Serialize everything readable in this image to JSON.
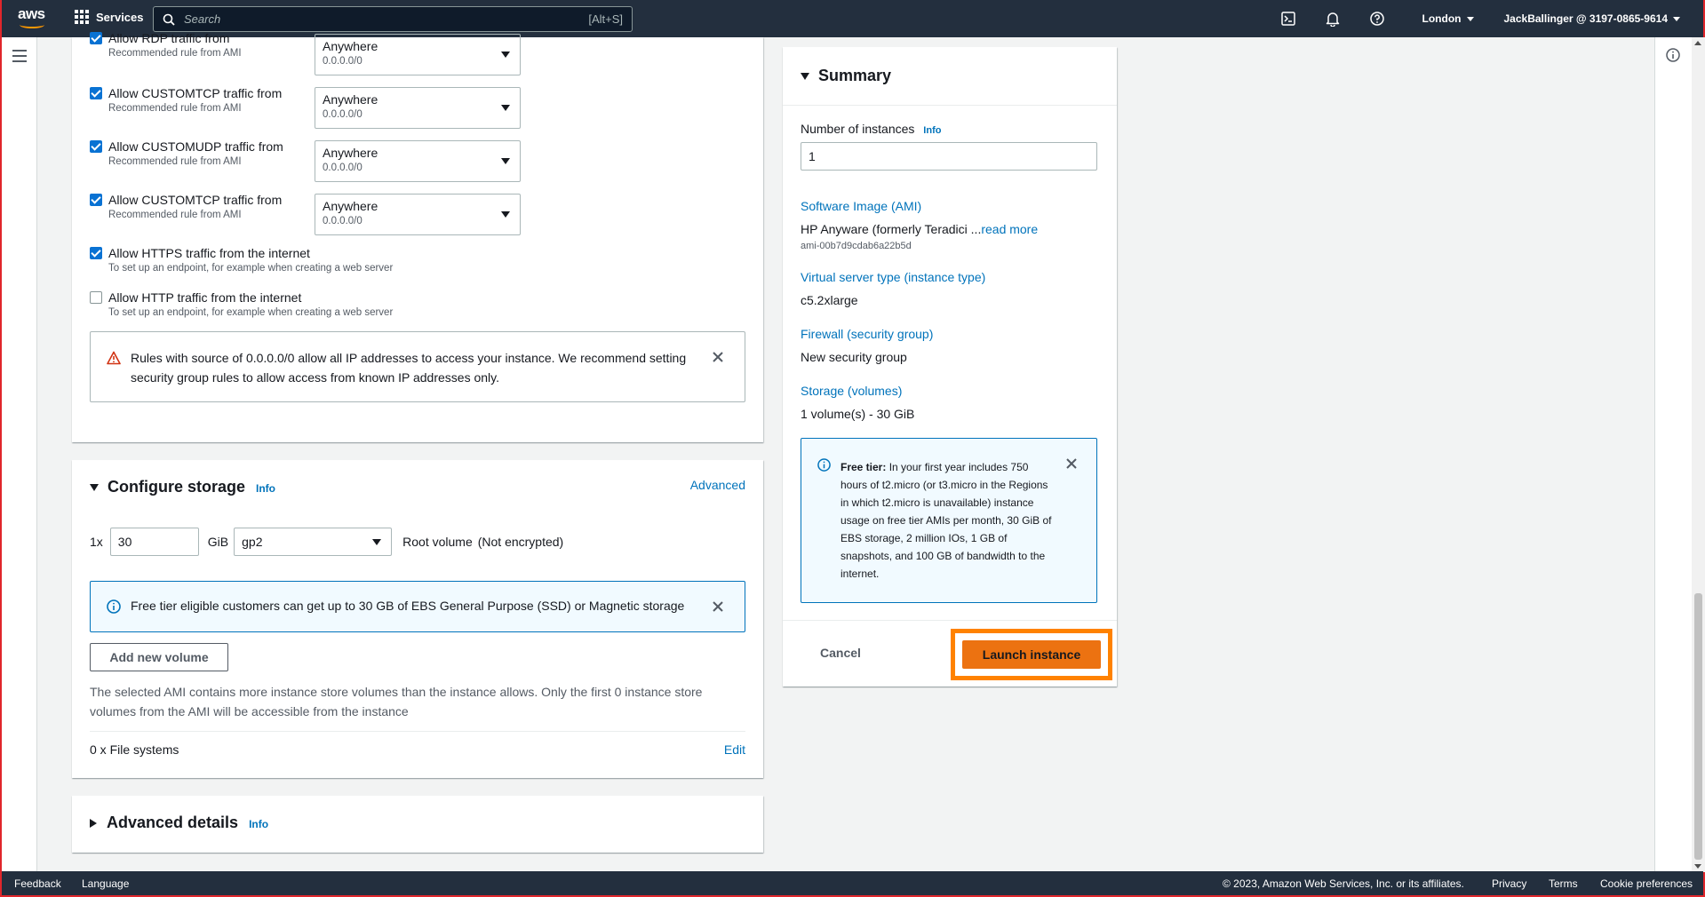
{
  "topnav": {
    "logo": "aws",
    "services_label": "Services",
    "search_placeholder": "Search",
    "search_shortcut": "[Alt+S]",
    "region": "London",
    "account": "JackBallinger @ 3197-0865-9614",
    "icons": [
      "cloudshell-icon",
      "notifications-icon",
      "help-icon"
    ]
  },
  "security_rules": [
    {
      "title": "Allow RDP traffic from",
      "subtitle": "Recommended rule from AMI",
      "checked": true,
      "source": "Anywhere",
      "cidr": "0.0.0.0/0"
    },
    {
      "title": "Allow CUSTOMTCP traffic from",
      "subtitle": "Recommended rule from AMI",
      "checked": true,
      "source": "Anywhere",
      "cidr": "0.0.0.0/0"
    },
    {
      "title": "Allow CUSTOMUDP traffic from",
      "subtitle": "Recommended rule from AMI",
      "checked": true,
      "source": "Anywhere",
      "cidr": "0.0.0.0/0"
    },
    {
      "title": "Allow CUSTOMTCP traffic from",
      "subtitle": "Recommended rule from AMI",
      "checked": true,
      "source": "Anywhere",
      "cidr": "0.0.0.0/0"
    },
    {
      "title": "Allow HTTPS traffic from the internet",
      "subtitle": "To set up an endpoint, for example when creating a web server",
      "checked": true
    },
    {
      "title": "Allow HTTP traffic from the internet",
      "subtitle": "To set up an endpoint, for example when creating a web server",
      "checked": false
    }
  ],
  "warning": "Rules with source of 0.0.0.0/0 allow all IP addresses to access your instance. We recommend setting security group rules to allow access from known IP addresses only.",
  "storage": {
    "title": "Configure storage",
    "info": "Info",
    "advanced": "Advanced",
    "count": "1x",
    "size": "30",
    "unit": "GiB",
    "volume_type": "gp2",
    "root_label": "Root volume",
    "encryption": "(Not encrypted)",
    "free_tier_note": "Free tier eligible customers can get up to 30 GB of EBS General Purpose (SSD) or Magnetic storage",
    "add_volume": "Add new volume",
    "ami_note": "The selected AMI contains more instance store volumes than the instance allows. Only the first 0 instance store volumes from the AMI will be accessible from the instance",
    "file_systems": "0 x File systems",
    "edit": "Edit"
  },
  "advanced_details": {
    "title": "Advanced details",
    "info": "Info"
  },
  "summary": {
    "title": "Summary",
    "instances_label": "Number of instances",
    "info": "Info",
    "instances_value": "1",
    "ami_label": "Software Image (AMI)",
    "ami_value": "HP Anyware (formerly Teradici ...",
    "read_more": "read more",
    "ami_id": "ami-00b7d9cdab6a22b5d",
    "type_label": "Virtual server type (instance type)",
    "type_value": "c5.2xlarge",
    "firewall_label": "Firewall (security group)",
    "firewall_value": "New security group",
    "storage_label": "Storage (volumes)",
    "storage_value": "1 volume(s) - 30 GiB",
    "free_tier_title": "Free tier:",
    "free_tier_body": "In your first year includes 750 hours of t2.micro (or t3.micro in the Regions in which t2.micro is unavailable) instance usage on free tier AMIs per month, 30 GiB of EBS storage, 2 million IOs, 1 GB of snapshots, and 100 GB of bandwidth to the internet.",
    "cancel": "Cancel",
    "launch": "Launch instance"
  },
  "footer": {
    "feedback": "Feedback",
    "language": "Language",
    "copyright": "© 2023, Amazon Web Services, Inc. or its affiliates.",
    "privacy": "Privacy",
    "terms": "Terms",
    "cookies": "Cookie preferences"
  },
  "colors": {
    "nav_bg": "#232f3e",
    "accent_orange": "#ec7211",
    "highlight_orange": "#ff8200",
    "link_blue": "#0073bb",
    "checkbox_blue": "#0972d3",
    "warning_red": "#d13212"
  }
}
